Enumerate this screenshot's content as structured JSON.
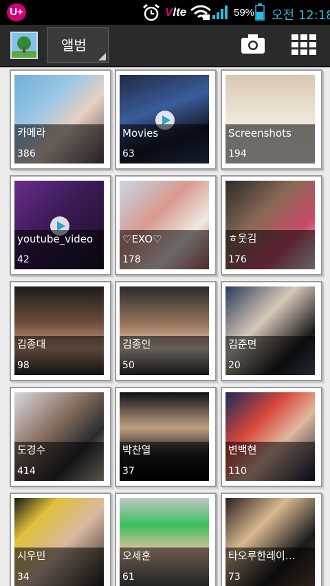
{
  "status_bar": {
    "carrier": "U+",
    "network_v": "V",
    "network_lte": "lte",
    "battery_percent": "59%",
    "time": "오전 12:18",
    "accent_color": "#26bde0"
  },
  "action_bar": {
    "album_button_label": "앨범",
    "camera_icon": "camera-icon",
    "grid_icon": "grid-view-icon"
  },
  "albums": [
    {
      "name": "카메라",
      "count": "386",
      "video": false,
      "bg": "linear-gradient(135deg,#6fb0d8 0%,#9bc6e6 35%,#e8d0c2 60%,#5a4a52 100%)"
    },
    {
      "name": "Movies",
      "count": "63",
      "video": true,
      "bg": "linear-gradient(160deg,#1f2a44 0%,#3a5d9a 40%,#141a2a 70%,#2c3f6b 100%)"
    },
    {
      "name": "Screenshots",
      "count": "194",
      "video": false,
      "bg": "linear-gradient(180deg,#d8c8b2 0%,#efe6d8 50%,#f7f2ea 100%)"
    },
    {
      "name": "youtube_video",
      "count": "42",
      "video": true,
      "bg": "linear-gradient(135deg,#6a2d8c 0%,#3a1a55 45%,#1c1027 100%)"
    },
    {
      "name": "♡EXO♡",
      "count": "178",
      "video": false,
      "bg": "linear-gradient(135deg,#c7d7e8 0%,#d89a8e 40%,#f0e8e0 70%,#b06060 100%)"
    },
    {
      "name": "ㅎ웃김",
      "count": "176",
      "video": false,
      "bg": "linear-gradient(135deg,#2b2b2b 0%,#8a6a55 40%,#c94a6a 70%,#dedede 100%)"
    },
    {
      "name": "김종대",
      "count": "98",
      "video": false,
      "bg": "linear-gradient(180deg,#1c1c1c 0%,#6b4a3a 40%,#c89a80 70%,#2a2a2a 100%)"
    },
    {
      "name": "김종인",
      "count": "50",
      "video": false,
      "bg": "linear-gradient(180deg,#2a2a2a 0%,#a07a60 45%,#e0d0c0 70%,#303030 100%)"
    },
    {
      "name": "김준면",
      "count": "20",
      "video": false,
      "bg": "linear-gradient(135deg,#2a3a5a 0%,#d8c8b8 40%,#1a1a1a 75%,#4a5a7a 100%)"
    },
    {
      "name": "도경수",
      "count": "414",
      "video": false,
      "bg": "linear-gradient(135deg,#d8d8e0 0%,#8a7060 40%,#2a2a30 70%,#c8b8a8 100%)"
    },
    {
      "name": "박찬열",
      "count": "37",
      "video": false,
      "bg": "linear-gradient(180deg,#101018 0%,#c0a080 40%,#202028 70%,#000 100%)"
    },
    {
      "name": "변백현",
      "count": "110",
      "video": false,
      "bg": "linear-gradient(135deg,#1a2a5a 0%,#d8483a 35%,#e0b8a0 60%,#101a3a 100%)"
    },
    {
      "name": "시우민",
      "count": "34",
      "video": false,
      "bg": "linear-gradient(135deg,#181818 0%,#e0c03a 25%,#d8b8a0 55%,#202020 100%)"
    },
    {
      "name": "오세훈",
      "count": "61",
      "video": false,
      "bg": "linear-gradient(180deg,#c0c8c8 0%,#3ac05a 30%,#e0c0a0 60%,#505050 100%)"
    },
    {
      "name": "타오루한레이…",
      "count": "73",
      "video": false,
      "bg": "linear-gradient(135deg,#2a2020 0%,#d8b890 35%,#1a1a1a 70%,#6a4a3a 100%)"
    }
  ]
}
